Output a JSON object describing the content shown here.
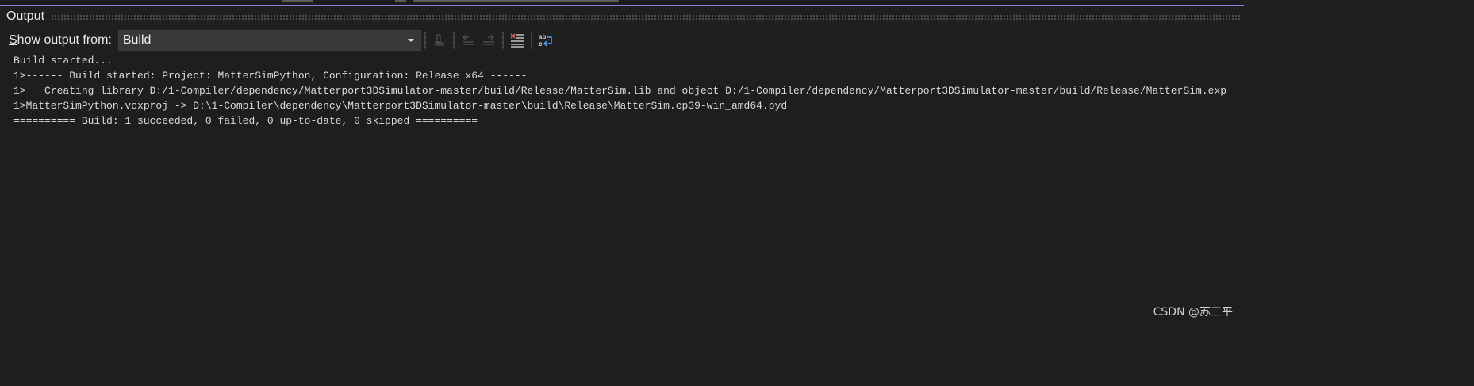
{
  "panel": {
    "title": "Output"
  },
  "toolbar": {
    "show_output_accesskey": "S",
    "show_output_rest": "how output from:",
    "source_selected": "Build",
    "buttons": [
      {
        "name": "find-message-in-code-icon",
        "enabled": false
      },
      {
        "name": "go-to-previous-message-icon",
        "enabled": false
      },
      {
        "name": "go-to-next-message-icon",
        "enabled": false
      },
      {
        "name": "clear-all-icon",
        "enabled": true
      },
      {
        "name": "toggle-word-wrap-icon",
        "enabled": true
      }
    ]
  },
  "output": {
    "lines": [
      "Build started...",
      "1>------ Build started: Project: MatterSimPython, Configuration: Release x64 ------",
      "1>   Creating library D:/1-Compiler/dependency/Matterport3DSimulator-master/build/Release/MatterSim.lib and object D:/1-Compiler/dependency/Matterport3DSimulator-master/build/Release/MatterSim.exp",
      "1>MatterSimPython.vcxproj -> D:\\1-Compiler\\dependency\\Matterport3DSimulator-master\\build\\Release\\MatterSim.cp39-win_amd64.pyd",
      "========== Build: 1 succeeded, 0 failed, 0 up-to-date, 0 skipped =========="
    ]
  },
  "watermark": "CSDN @苏三平",
  "colors": {
    "background": "#1f1f1f",
    "accent": "#8c7ce0",
    "text": "#dadada",
    "clear_icon_red": "#e05a5a",
    "wrap_icon_blue": "#4aa3ff"
  }
}
